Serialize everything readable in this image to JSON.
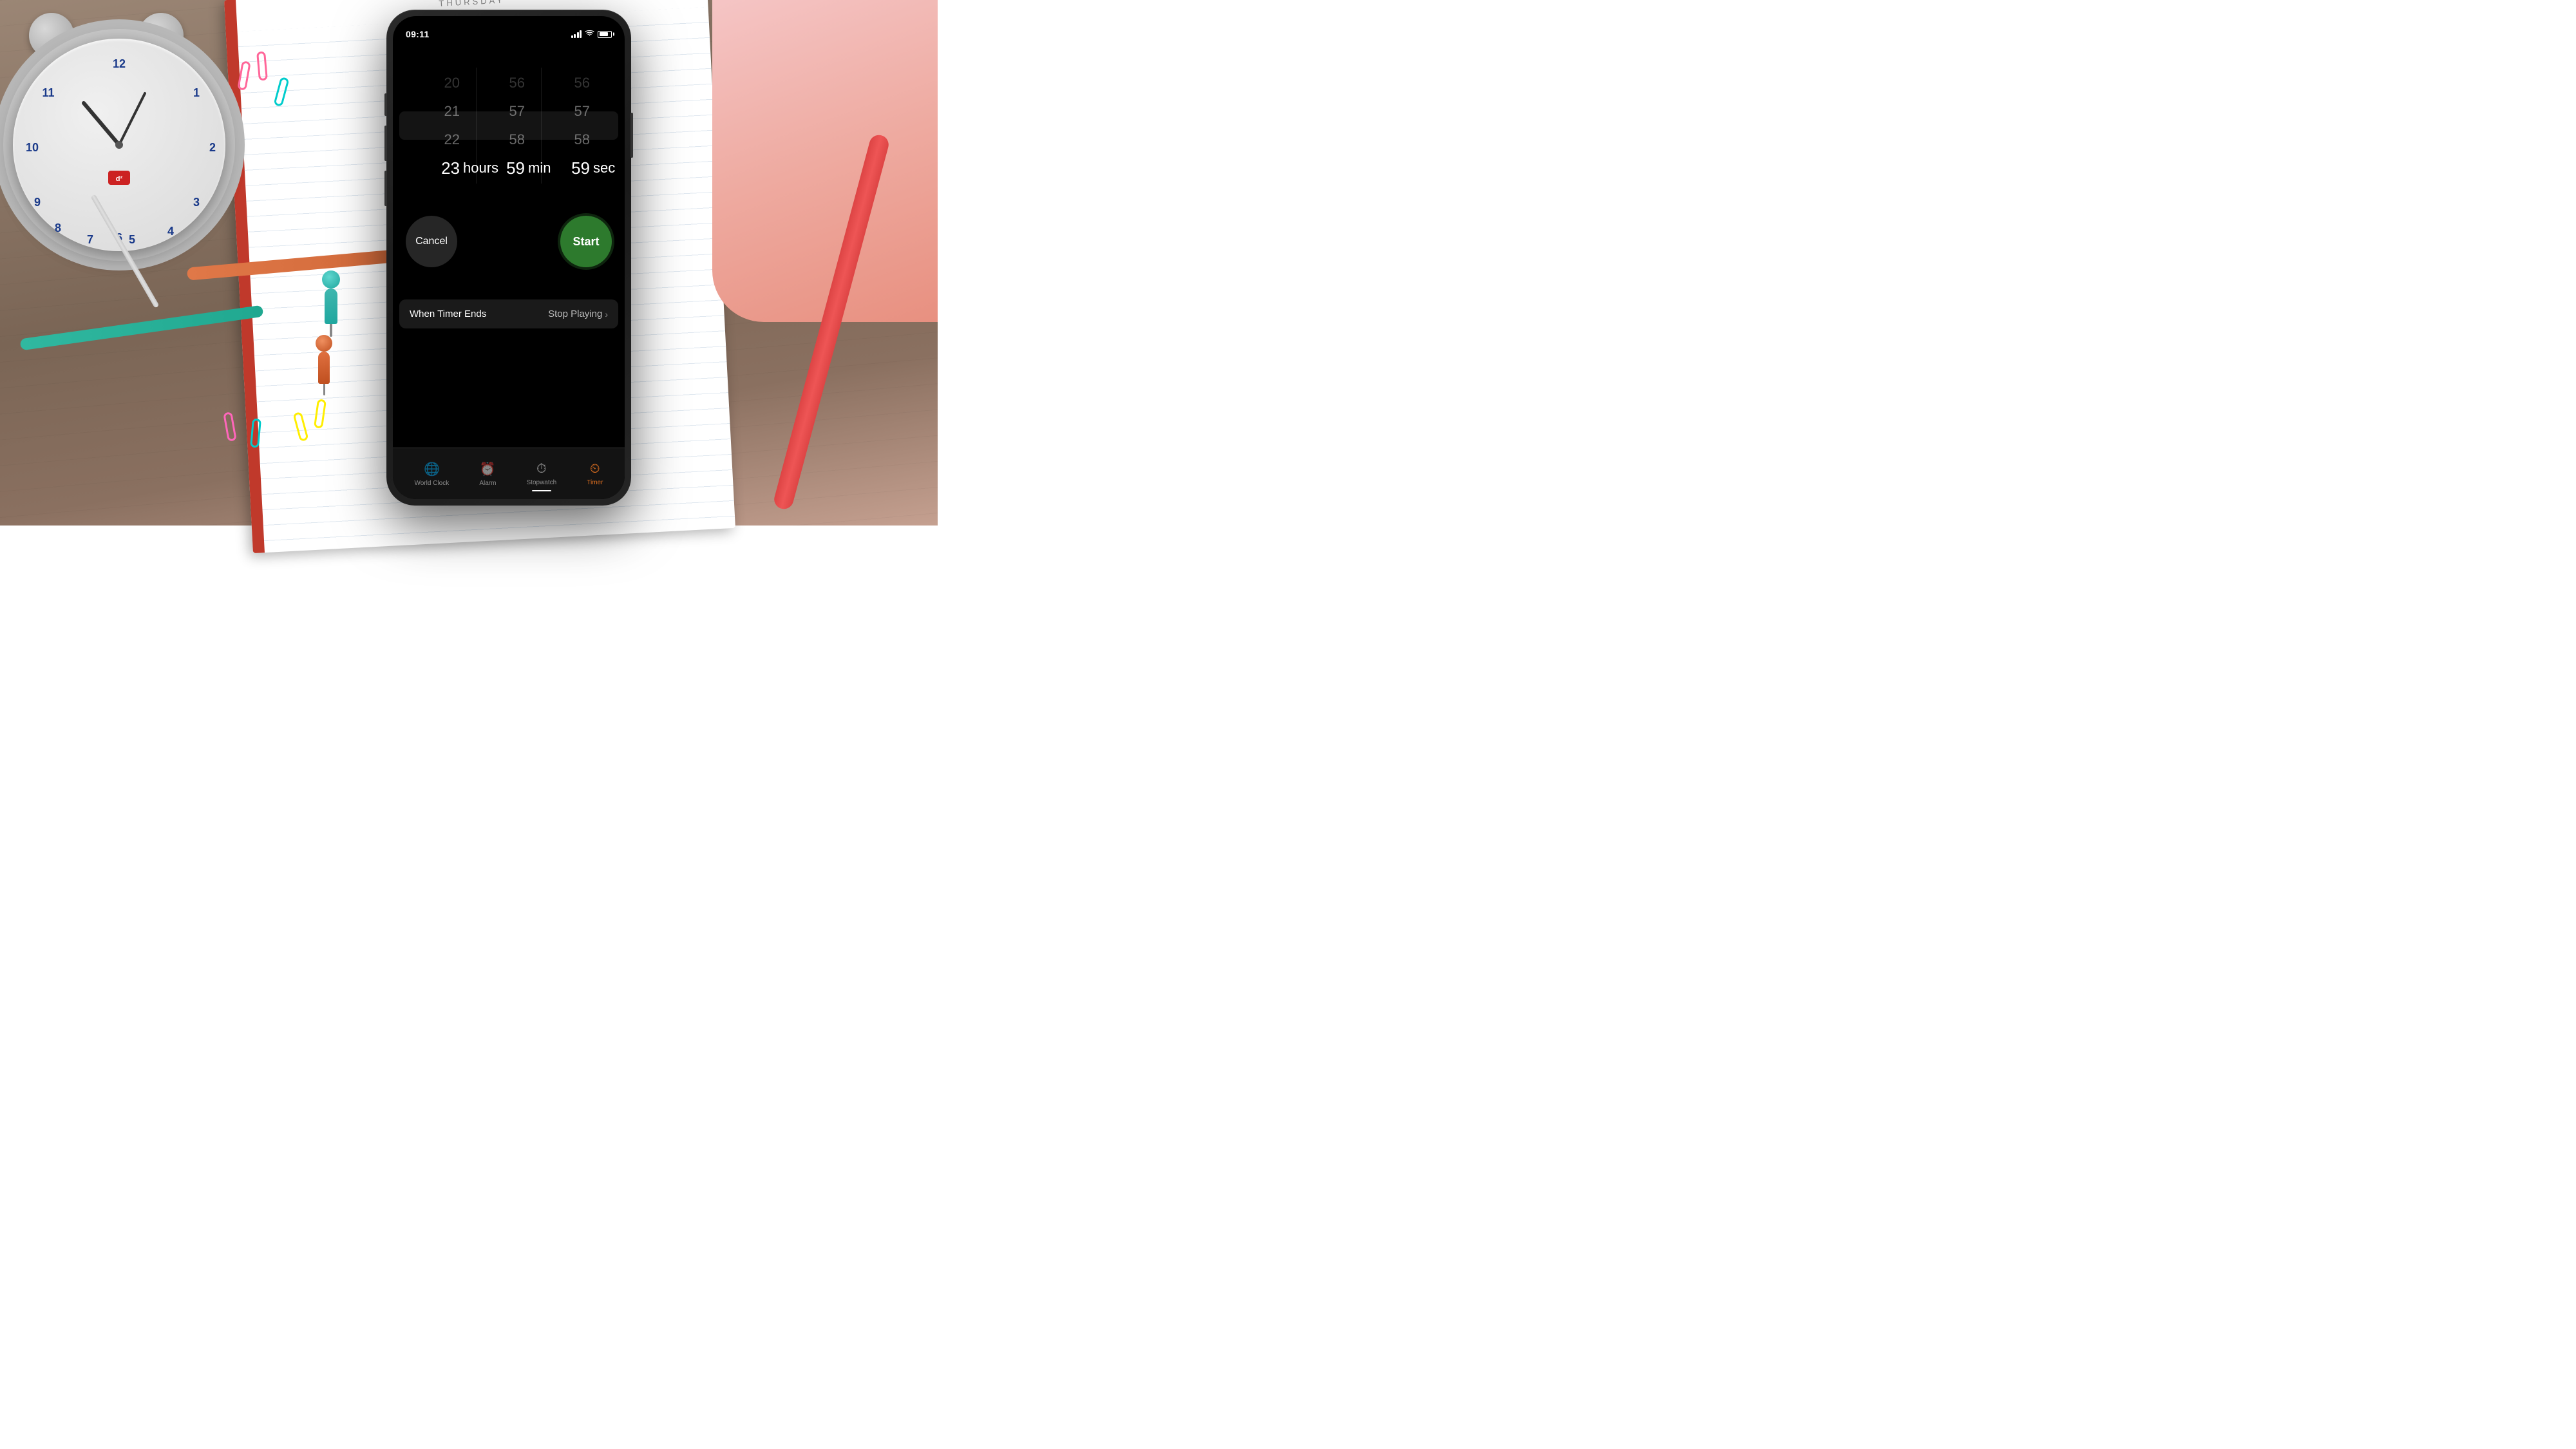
{
  "background": {
    "notebook_day": "THURSDAY"
  },
  "statusBar": {
    "time": "09:11",
    "signal": "●●●",
    "wifi": "wifi",
    "battery": "battery"
  },
  "picker": {
    "hours": {
      "above2": "20",
      "above1": "21",
      "above0": "22",
      "selected": "23",
      "label": "hours"
    },
    "minutes": {
      "above2": "56",
      "above1": "57",
      "above0": "58",
      "selected": "59",
      "label": "min"
    },
    "seconds": {
      "above2": "56",
      "above1": "57",
      "above0": "58",
      "selected": "59",
      "label": "sec"
    }
  },
  "buttons": {
    "cancel": "Cancel",
    "start": "Start"
  },
  "timerEnds": {
    "label": "When Timer Ends",
    "value": "Stop Playing"
  },
  "tabBar": {
    "tabs": [
      {
        "id": "world-clock",
        "label": "World Clock",
        "icon": "🌐",
        "active": false
      },
      {
        "id": "alarm",
        "label": "Alarm",
        "icon": "⏰",
        "active": false
      },
      {
        "id": "stopwatch",
        "label": "Stopwatch",
        "icon": "⏱",
        "active": false
      },
      {
        "id": "timer",
        "label": "Timer",
        "icon": "⏲",
        "active": true
      }
    ]
  }
}
